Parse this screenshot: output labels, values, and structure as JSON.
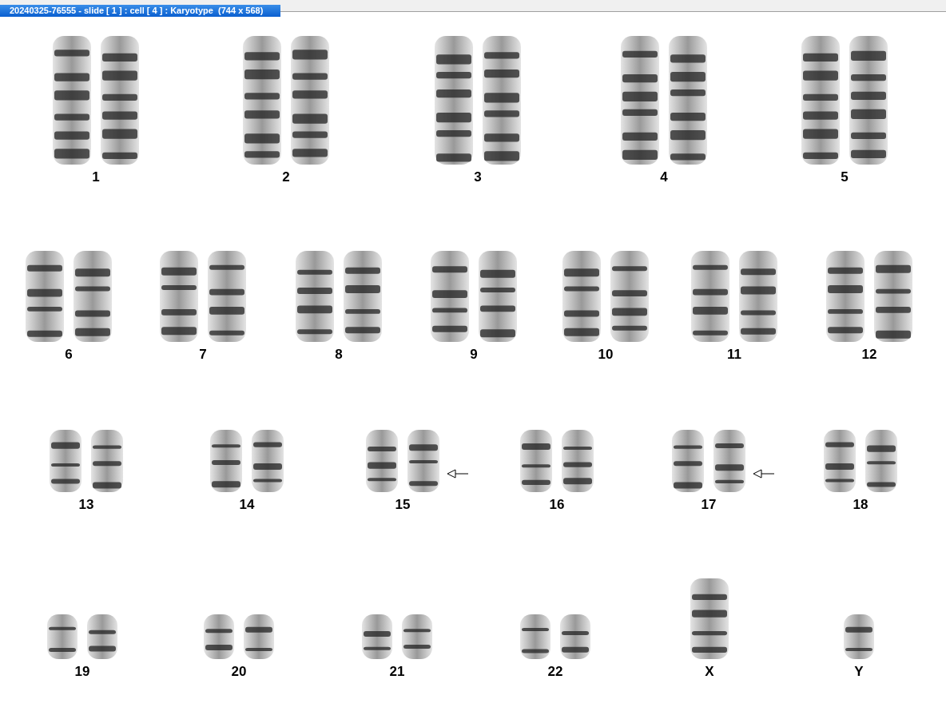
{
  "window": {
    "title": "20240325-76555 - slide [ 1 ] : cell [ 4 ] : Karyotype  (744 x 568)"
  },
  "karyotype": {
    "rows": [
      {
        "chromosomes": [
          {
            "label": "1",
            "kind": "pair",
            "marked": false
          },
          {
            "label": "2",
            "kind": "pair",
            "marked": false
          },
          {
            "label": "3",
            "kind": "pair",
            "marked": false
          },
          {
            "label": "4",
            "kind": "pair",
            "marked": false
          },
          {
            "label": "5",
            "kind": "pair",
            "marked": false
          }
        ]
      },
      {
        "chromosomes": [
          {
            "label": "6",
            "kind": "pair",
            "marked": false
          },
          {
            "label": "7",
            "kind": "pair",
            "marked": false
          },
          {
            "label": "8",
            "kind": "pair",
            "marked": false
          },
          {
            "label": "9",
            "kind": "pair",
            "marked": false
          },
          {
            "label": "10",
            "kind": "pair",
            "marked": false
          },
          {
            "label": "11",
            "kind": "pair",
            "marked": false
          },
          {
            "label": "12",
            "kind": "pair",
            "marked": false
          }
        ]
      },
      {
        "chromosomes": [
          {
            "label": "13",
            "kind": "pair",
            "marked": false
          },
          {
            "label": "14",
            "kind": "pair",
            "marked": false
          },
          {
            "label": "15",
            "kind": "pair",
            "marked": true
          },
          {
            "label": "16",
            "kind": "pair",
            "marked": false
          },
          {
            "label": "17",
            "kind": "pair",
            "marked": true
          },
          {
            "label": "18",
            "kind": "pair",
            "marked": false
          }
        ]
      },
      {
        "chromosomes": [
          {
            "label": "19",
            "kind": "pair",
            "marked": false
          },
          {
            "label": "20",
            "kind": "pair",
            "marked": false
          },
          {
            "label": "21",
            "kind": "pair",
            "marked": false
          },
          {
            "label": "22",
            "kind": "pair",
            "marked": false
          },
          {
            "label": "X",
            "kind": "single",
            "marked": false
          },
          {
            "label": "Y",
            "kind": "single",
            "marked": false
          }
        ]
      }
    ]
  }
}
